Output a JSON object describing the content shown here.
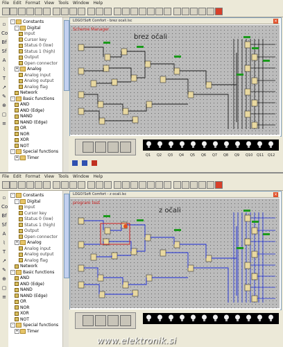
{
  "menu": [
    "File",
    "Edit",
    "Format",
    "View",
    "Tools",
    "Window",
    "Help"
  ],
  "sidebar_tree": [
    {
      "label": "Constants",
      "level": 0,
      "kind": "folder",
      "exp": "-"
    },
    {
      "label": "Digital",
      "level": 1,
      "kind": "folder",
      "exp": "-"
    },
    {
      "label": "Input",
      "level": 2,
      "kind": "block"
    },
    {
      "label": "Cursor key",
      "level": 2,
      "kind": "block"
    },
    {
      "label": "Status 0 (low)",
      "level": 2,
      "kind": "block"
    },
    {
      "label": "Status 1 (high)",
      "level": 2,
      "kind": "block"
    },
    {
      "label": "Output",
      "level": 2,
      "kind": "block"
    },
    {
      "label": "Open connector",
      "level": 2,
      "kind": "block"
    },
    {
      "label": "Analog",
      "level": 1,
      "kind": "folder",
      "exp": "+"
    },
    {
      "label": "Analog input",
      "level": 2,
      "kind": "block"
    },
    {
      "label": "Analog output",
      "level": 2,
      "kind": "block"
    },
    {
      "label": "Analog flag",
      "level": 2,
      "kind": "block"
    },
    {
      "label": "Network",
      "level": 1,
      "kind": "block"
    },
    {
      "label": "Basic functions",
      "level": 0,
      "kind": "folder",
      "exp": "-"
    },
    {
      "label": "AND",
      "level": 1,
      "kind": "block"
    },
    {
      "label": "AND (Edge)",
      "level": 1,
      "kind": "block"
    },
    {
      "label": "NAND",
      "level": 1,
      "kind": "block"
    },
    {
      "label": "NAND (Edge)",
      "level": 1,
      "kind": "block"
    },
    {
      "label": "OR",
      "level": 1,
      "kind": "block"
    },
    {
      "label": "NOR",
      "level": 1,
      "kind": "block"
    },
    {
      "label": "XOR",
      "level": 1,
      "kind": "block"
    },
    {
      "label": "NOT",
      "level": 1,
      "kind": "block"
    },
    {
      "label": "Special functions",
      "level": 0,
      "kind": "folder",
      "exp": "-"
    },
    {
      "label": "Timer",
      "level": 1,
      "kind": "folder",
      "exp": "+"
    }
  ],
  "panels": [
    {
      "doc_title": "LOGO!Soft Comfort - brez ocali.lsc",
      "program_name": "Scheme Manager",
      "circuit_label": "brez očali"
    },
    {
      "doc_title": "LOGO!Soft Comfort - z ocali.lsc",
      "program_name": "program test",
      "circuit_label": "z očali"
    }
  ],
  "output_labels": [
    "Q1",
    "Q2",
    "Q3",
    "Q4",
    "Q5",
    "Q6",
    "Q7",
    "Q8",
    "Q9",
    "Q10",
    "Q11",
    "Q12"
  ],
  "watermark": "www.elektronik.si",
  "colors": {
    "canvas": "#bcbcbc",
    "wire_dark": "#1a1a1a",
    "wire_blue": "#1a2ad8",
    "wire_red": "#d02020",
    "wire_green": "#1a9a1a",
    "block_fill": "#e8d8a0",
    "bulb": "#f0f0f0",
    "bulb_bar": "#000000"
  }
}
